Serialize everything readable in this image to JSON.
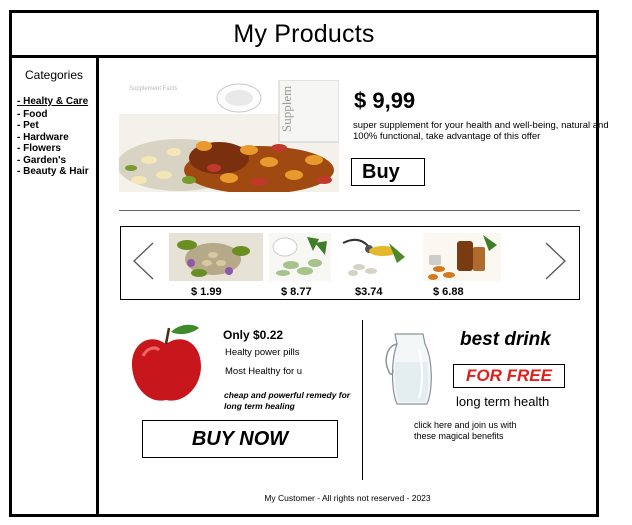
{
  "header": {
    "title": "My Products"
  },
  "sidebar": {
    "title": "Categories",
    "items": [
      {
        "label": "- Healty & Care",
        "active": true
      },
      {
        "label": "- Food"
      },
      {
        "label": "- Pet"
      },
      {
        "label": "- Hardware"
      },
      {
        "label": "- Flowers"
      },
      {
        "label": "- Garden's"
      },
      {
        "label": "- Beauty & Hair"
      }
    ]
  },
  "hero": {
    "image_icon": "supplement-pills-image",
    "image_text": "Supplem",
    "image_text_small": "Supplement Facts",
    "price": "$ 9,99",
    "description": "super supplement for your health and well-being, natural and 100% functional, take advantage of this offer",
    "buy_label": "Buy"
  },
  "carousel": {
    "prev_icon": "chevron-left-icon",
    "next_icon": "chevron-right-icon",
    "items": [
      {
        "price": "$ 1.99",
        "icon": "herbal-pills-image"
      },
      {
        "price": "$ 8.77",
        "icon": "green-capsules-image"
      },
      {
        "price": "$3.74",
        "icon": "pills-stethoscope-image"
      },
      {
        "price": "$ 6.88",
        "icon": "supplement-bottles-image"
      }
    ]
  },
  "promo_left": {
    "icon": "apple-image",
    "price": "Only $0.22",
    "line1": "Healty power pills",
    "line2": "Most Healthy for u",
    "note": "cheap and powerful remedy for long term healing",
    "buy_now_label": "BUY NOW"
  },
  "promo_right": {
    "icon": "water-jug-image",
    "title": "best drink",
    "free_label": "FOR FREE",
    "subtitle": "long term health",
    "cta": "click here and join us with these magical benefits"
  },
  "footer": {
    "text": "My Customer - All rights not reserved - 2023"
  },
  "colors": {
    "accent_red": "#e0201f",
    "border": "#000000"
  }
}
